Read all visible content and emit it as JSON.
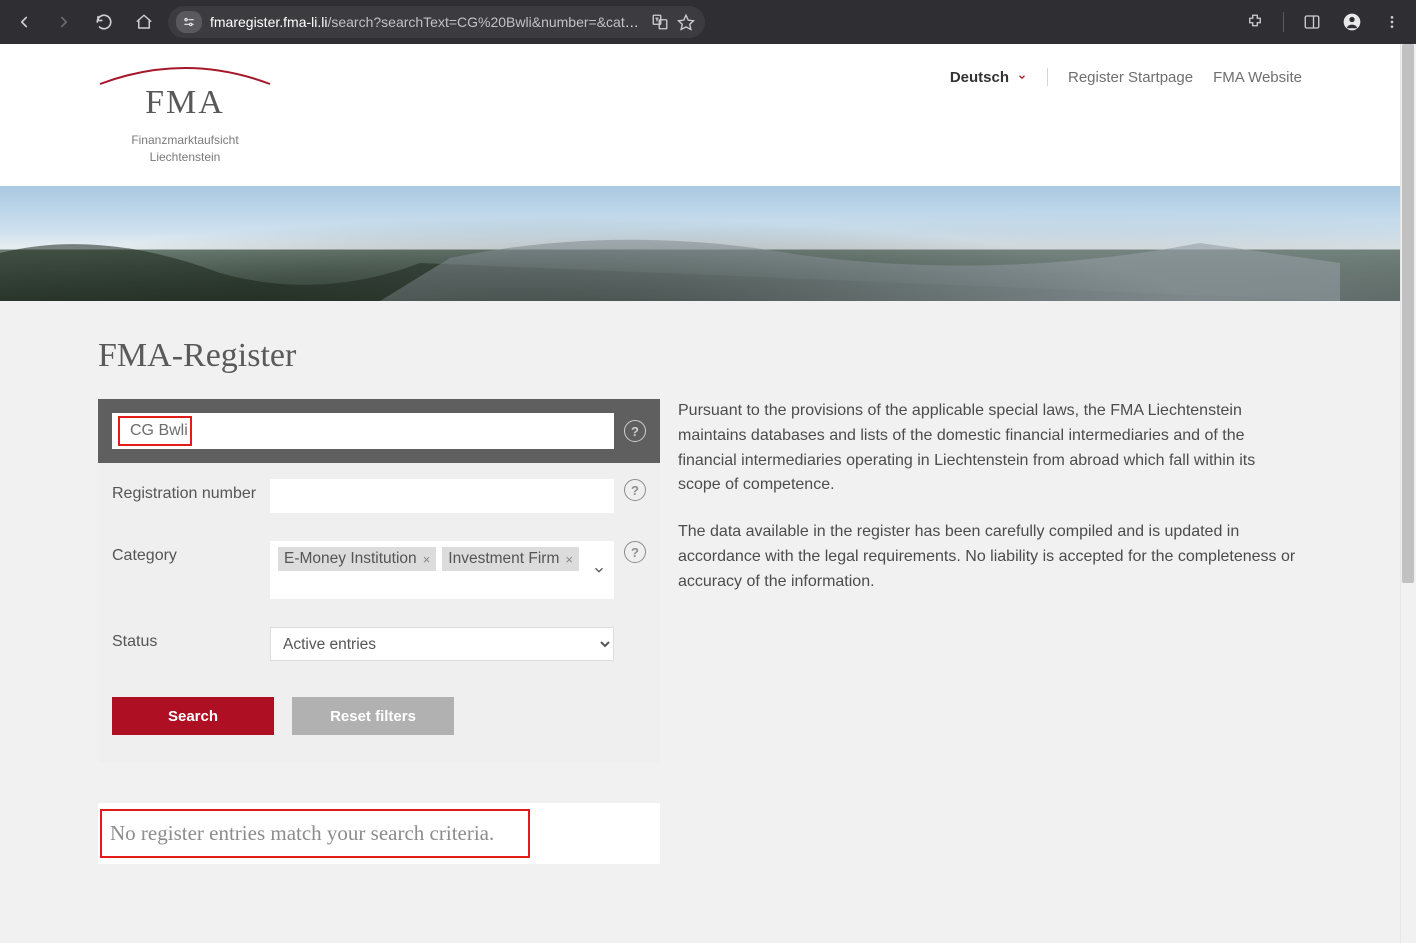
{
  "browser": {
    "url_domain": "fmaregister.fma-li.li",
    "url_path": "/search?searchText=CG%20Bwli&number=&category=5&category=51&searchInvalid=false&searchType=active&sortColum…"
  },
  "logo": {
    "name": "FMA",
    "sub1": "Finanzmarktaufsicht",
    "sub2": "Liechtenstein"
  },
  "header": {
    "language": "Deutsch",
    "links": {
      "register_start": "Register Startpage",
      "fma_site": "FMA Website"
    }
  },
  "page": {
    "title": "FMA-Register"
  },
  "search": {
    "value": "CG Bwli",
    "labels": {
      "reg_number": "Registration number",
      "category": "Category",
      "status": "Status"
    },
    "category_tags": [
      "E-Money Institution",
      "Investment Firm"
    ],
    "status_options": [
      "Active entries"
    ],
    "buttons": {
      "search": "Search",
      "reset": "Reset filters"
    }
  },
  "info": {
    "p1": "Pursuant to the provisions of the applicable special laws, the FMA Liechtenstein maintains databases and lists of the domestic financial intermediaries and of the financial intermediaries operating in Liechtenstein from abroad which fall within its scope of competence.",
    "p2": "The data available in the register has been carefully compiled and is updated in accordance with the legal requirements. No liability is accepted for the completeness or accuracy of the information."
  },
  "results": {
    "empty_message": "No register entries match your search criteria."
  }
}
